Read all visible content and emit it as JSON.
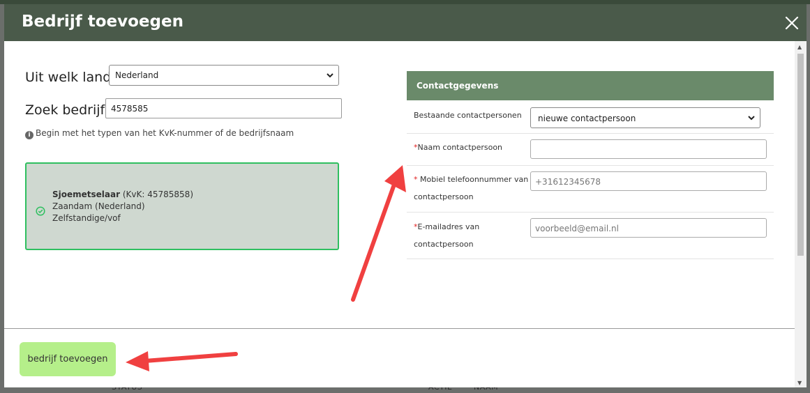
{
  "modal": {
    "title": "Bedrijf toevoegen",
    "country_label": "Uit welk land:",
    "country_value": "Nederland",
    "search_label": "Zoek bedrijf:",
    "search_value": "4578585",
    "hint": "Begin met het typen van het KvK-nummer of de bedrijfsnaam",
    "company": {
      "name": "Sjoemetselaar",
      "kvk": "(KvK: 45785858)",
      "location": "Zaandam (Nederland)",
      "type": "Zelfstandige/vof"
    },
    "contact": {
      "title": "Contactgegevens",
      "existing_label": "Bestaande contactpersonen",
      "existing_value": "nieuwe contactpersoon",
      "name_label": "Naam contactpersoon",
      "phone_label_1": "Mobiel telefoonnummer van",
      "phone_label_2": "contactpersoon",
      "phone_placeholder": "+31612345678",
      "email_label_1": "E-mailadres van",
      "email_label_2": "contactpersoon",
      "email_placeholder": "voorbeeld@email.nl",
      "required_mark": "*"
    },
    "add_button": "bedrijf toevoegen"
  },
  "background": {
    "footer_status": "STATUS",
    "footer_actie": "ACTIE",
    "footer_naam": "NAAM"
  },
  "colors": {
    "header": "#4a5a4a",
    "contact_header": "#6a8a6a",
    "card_border": "#2fbf60",
    "button": "#b5ef8a",
    "arrow": "#f04040"
  }
}
